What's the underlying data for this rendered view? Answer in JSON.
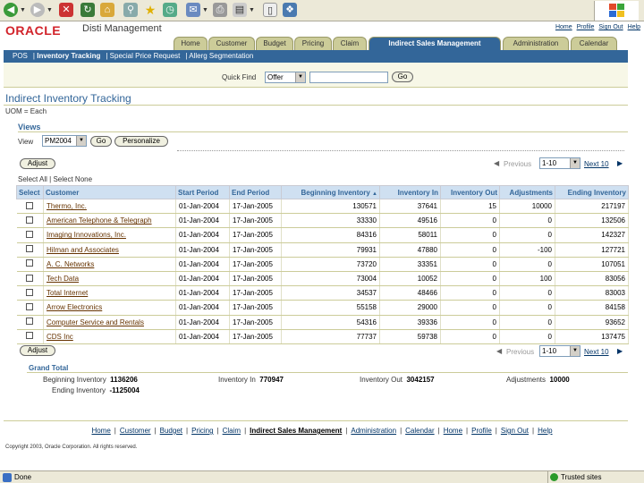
{
  "brand": {
    "logo": "ORACLE",
    "app_name": "Disti Management"
  },
  "global_links": [
    "Home",
    "Profile",
    "Sign Out",
    "Help"
  ],
  "tabs": [
    "Home",
    "Customer",
    "Budget",
    "Pricing",
    "Claim",
    "Indirect Sales Management",
    "Administration",
    "Calendar"
  ],
  "active_tab": "Indirect Sales Management",
  "subnav": [
    "POS",
    "Inventory Tracking",
    "Special Price Request",
    "Allerg Segmentation"
  ],
  "active_subnav": "Inventory Tracking",
  "quick_find": {
    "label": "Quick Find",
    "selected": "Offer",
    "value": "",
    "go": "Go"
  },
  "page": {
    "title": "Indirect Inventory Tracking",
    "uom": "UOM = Each"
  },
  "views": {
    "header": "Views",
    "label": "View",
    "selected": "PM2004",
    "go": "Go",
    "personalize": "Personalize"
  },
  "adjust_label": "Adjust",
  "pager": {
    "previous": "Previous",
    "range": "1-10",
    "next": "Next 10"
  },
  "select_all": "Select All",
  "select_none": "Select None",
  "columns": [
    "Select",
    "Customer",
    "Start Period",
    "End Period",
    "Beginning Inventory",
    "Inventory In",
    "Inventory Out",
    "Adjustments",
    "Ending Inventory"
  ],
  "rows": [
    {
      "customer": "Thermo, Inc.",
      "start": "01-Jan-2004",
      "end": "17-Jan-2005",
      "begin": "130571",
      "in": "37641",
      "out": "15",
      "adj": "10000",
      "ending": "217197"
    },
    {
      "customer": "American Telephone & Telegraph",
      "start": "01-Jan-2004",
      "end": "17-Jan-2005",
      "begin": "33330",
      "in": "49516",
      "out": "0",
      "adj": "0",
      "ending": "132506"
    },
    {
      "customer": "Imaging Innovations, Inc.",
      "start": "01-Jan-2004",
      "end": "17-Jan-2005",
      "begin": "84316",
      "in": "58011",
      "out": "0",
      "adj": "0",
      "ending": "142327"
    },
    {
      "customer": "Hilman and Associates",
      "start": "01-Jan-2004",
      "end": "17-Jan-2005",
      "begin": "79931",
      "in": "47880",
      "out": "0",
      "adj": "-100",
      "ending": "127721"
    },
    {
      "customer": "A. C. Networks",
      "start": "01-Jan-2004",
      "end": "17-Jan-2005",
      "begin": "73720",
      "in": "33351",
      "out": "0",
      "adj": "0",
      "ending": "107051"
    },
    {
      "customer": "Tech Data",
      "start": "01-Jan-2004",
      "end": "17-Jan-2005",
      "begin": "73004",
      "in": "10052",
      "out": "0",
      "adj": "100",
      "ending": "83056"
    },
    {
      "customer": "Total Internet",
      "start": "01-Jan-2004",
      "end": "17-Jan-2005",
      "begin": "34537",
      "in": "48466",
      "out": "0",
      "adj": "0",
      "ending": "83003"
    },
    {
      "customer": "Arrow Electronics",
      "start": "01-Jan-2004",
      "end": "17-Jan-2005",
      "begin": "55158",
      "in": "29000",
      "out": "0",
      "adj": "0",
      "ending": "84158"
    },
    {
      "customer": "Computer Service and Rentals",
      "start": "01-Jan-2004",
      "end": "17-Jan-2005",
      "begin": "54316",
      "in": "39336",
      "out": "0",
      "adj": "0",
      "ending": "93652"
    },
    {
      "customer": "CDS Inc",
      "start": "01-Jan-2004",
      "end": "17-Jan-2005",
      "begin": "77737",
      "in": "59738",
      "out": "0",
      "adj": "0",
      "ending": "137475"
    }
  ],
  "grand_total": {
    "header": "Grand Total",
    "beginning_label": "Beginning Inventory",
    "beginning": "1136206",
    "in_label": "Inventory In",
    "in": "770947",
    "out_label": "Inventory Out",
    "out": "3042157",
    "adj_label": "Adjustments",
    "adj": "10000",
    "ending_label": "Ending Inventory",
    "ending": "-1125004"
  },
  "footer_links": [
    "Home",
    "Customer",
    "Budget",
    "Pricing",
    "Claim",
    "Indirect Sales Management",
    "Administration",
    "Calendar",
    "Home",
    "Profile",
    "Sign Out",
    "Help"
  ],
  "copyright": "Copyright 2003, Oracle Corporation. All rights reserved.",
  "status": {
    "left": "Done",
    "right": "Trusted sites"
  },
  "colors": {
    "brand_red": "#d2232a",
    "tab_active": "#336699",
    "tab_inactive": "#cccc99",
    "header_blue": "#cfe0f1",
    "link": "#663300"
  }
}
